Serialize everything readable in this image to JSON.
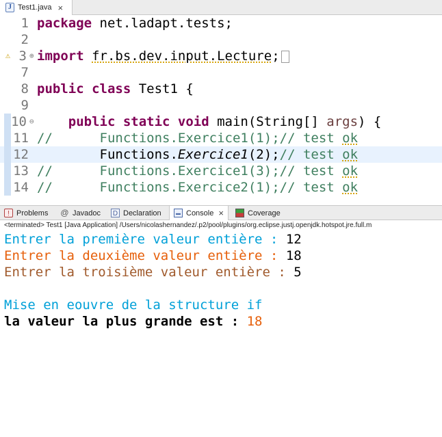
{
  "editor_tab": {
    "icon": "java-file-icon",
    "label": "Test1.java"
  },
  "colors": {
    "keyword": "#7f0055",
    "comment": "#3f7f5f",
    "line_number": "#787878",
    "current_line": "#e8f2fe",
    "console_cyan": "#00a0d8",
    "console_orange": "#e65f0a",
    "console_brown": "#a05a2c"
  },
  "code": {
    "l1": {
      "num": "1",
      "kw": "package",
      "rest": " net.ladapt.tests;"
    },
    "l2": {
      "num": "2"
    },
    "l3": {
      "num": "3",
      "kw": "import",
      "pkg": "fr.bs.dev.input.Lecture",
      "semi": ";"
    },
    "l7": {
      "num": "7"
    },
    "l8": {
      "num": "8",
      "kw": "public class",
      "rest": " Test1 {"
    },
    "l9": {
      "num": "9"
    },
    "l10": {
      "num": "10",
      "kw": "public static void",
      "rest": " main(String[] ",
      "param": "args",
      "end": ") {"
    },
    "l11": {
      "num": "11",
      "comment": "//",
      "call": "Functions.Exercice1(1);// test ",
      "ok": "ok"
    },
    "l12": {
      "num": "12",
      "class": "Functions.",
      "method": "Exercice1",
      "args": "(2);",
      "comment": "// test ",
      "ok": "ok"
    },
    "l13": {
      "num": "13",
      "comment": "//",
      "call": "Functions.Exercice1(3);// test ",
      "ok": "ok"
    },
    "l14": {
      "num": "14",
      "comment": "//",
      "call": "Functions.Exercice2(1);// test ",
      "ok": "ok"
    }
  },
  "views": {
    "problems": "Problems",
    "javadoc": "Javadoc",
    "declaration": "Declaration",
    "console": "Console",
    "coverage": "Coverage"
  },
  "console": {
    "header": "<terminated> Test1 [Java Application] /Users/nicolashernandez/.p2/pool/plugins/org.eclipse.justj.openjdk.hotspot.jre.full.m",
    "line1_prompt": "Entrer la première valeur entière : ",
    "line1_value": "12",
    "line2_prompt": "Entrer la deuxième valeur entière : ",
    "line2_value": "18",
    "line3_prompt": "Entrer la troisième valeur entière : ",
    "line3_value": "5",
    "line4": "Mise en eouvre de la structure if",
    "line5_text": "la valeur la plus grande est : ",
    "line5_value": "18"
  }
}
